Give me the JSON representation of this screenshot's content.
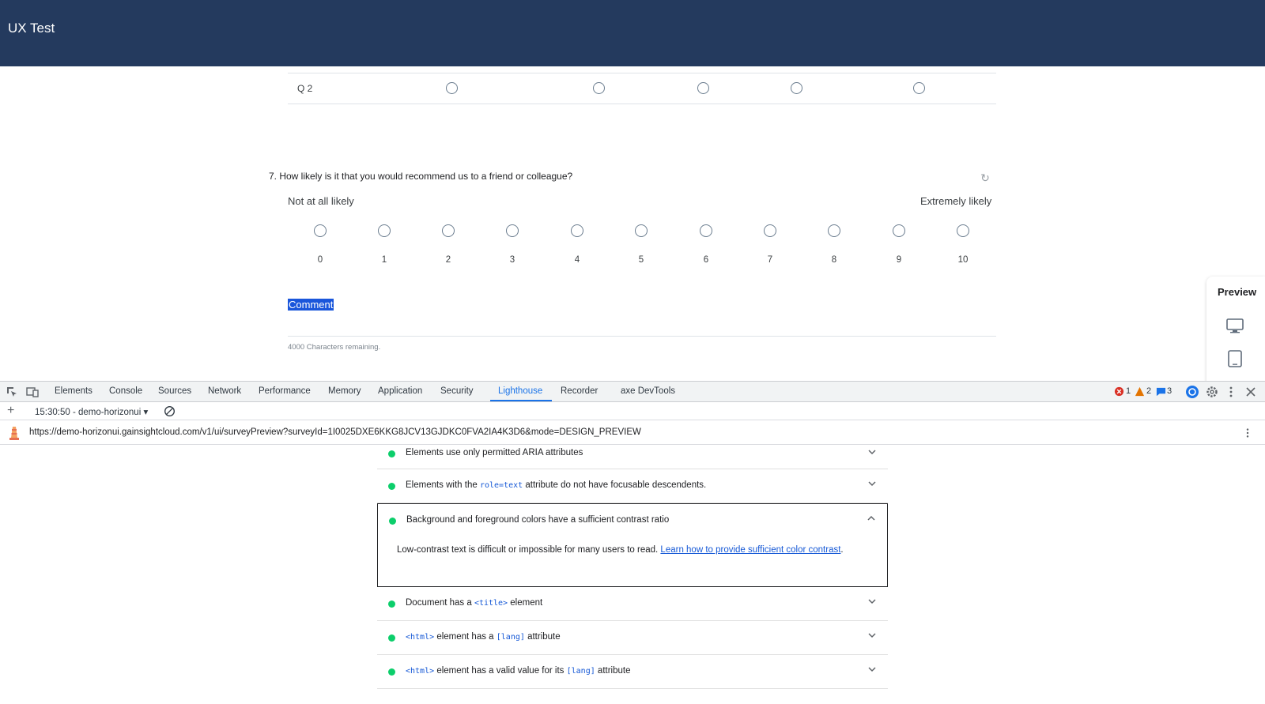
{
  "header": {
    "title": "UX Test"
  },
  "survey": {
    "matrix_row_label": "Q 2",
    "question7": "7. How likely is it that you would recommend us to a friend or colleague?",
    "nps_low_label": "Not at all likely",
    "nps_high_label": "Extremely likely",
    "nps_options": [
      "0",
      "1",
      "2",
      "3",
      "4",
      "5",
      "6",
      "7",
      "8",
      "9",
      "10"
    ],
    "comment_label": "Comment",
    "chars_remaining": "4000 Characters remaining."
  },
  "preview_panel": {
    "title": "Preview",
    "icons": [
      "desktop-icon",
      "tablet-icon",
      "mobile-icon"
    ]
  },
  "devtools": {
    "tabs": [
      "Elements",
      "Console",
      "Sources",
      "Network",
      "Performance",
      "Memory",
      "Application",
      "Security",
      "Lighthouse",
      "Recorder",
      "axe DevTools"
    ],
    "active_tab": "Lighthouse",
    "errors_count": "1",
    "warnings_count": "2",
    "messages_count": "3",
    "run_label": "15:30:50 - demo-horizonui",
    "url": "https://demo-horizonui.gainsightcloud.com/v1/ui/surveyPreview?surveyId=1I0025DXE6KKG8JCV13GJDKC0FVA2IA4K3D6&mode=DESIGN_PREVIEW",
    "audits": {
      "a1": "Elements use only permitted ARIA attributes",
      "a2_pre": "Elements with the ",
      "a2_code": "role=text",
      "a2_post": " attribute do not have focusable descendents.",
      "a3": "Background and foreground colors have a sufficient contrast ratio",
      "a3_desc": "Low-contrast text is difficult or impossible for many users to read. ",
      "a3_link": "Learn how to provide sufficient color contrast",
      "a3_period": ".",
      "a4_pre": "Document has a ",
      "a4_code": "<title>",
      "a4_post": " element",
      "a5_code1": "<html>",
      "a5_mid": " element has a ",
      "a5_code2": "[lang]",
      "a5_post": " attribute",
      "a6_code1": "<html>",
      "a6_mid": " element has a valid value for its ",
      "a6_code2": "[lang]",
      "a6_post": " attribute"
    }
  },
  "colors": {
    "header_bg": "#243a5e",
    "accent": "#1a73e8",
    "pass_green": "#0cce6b"
  }
}
